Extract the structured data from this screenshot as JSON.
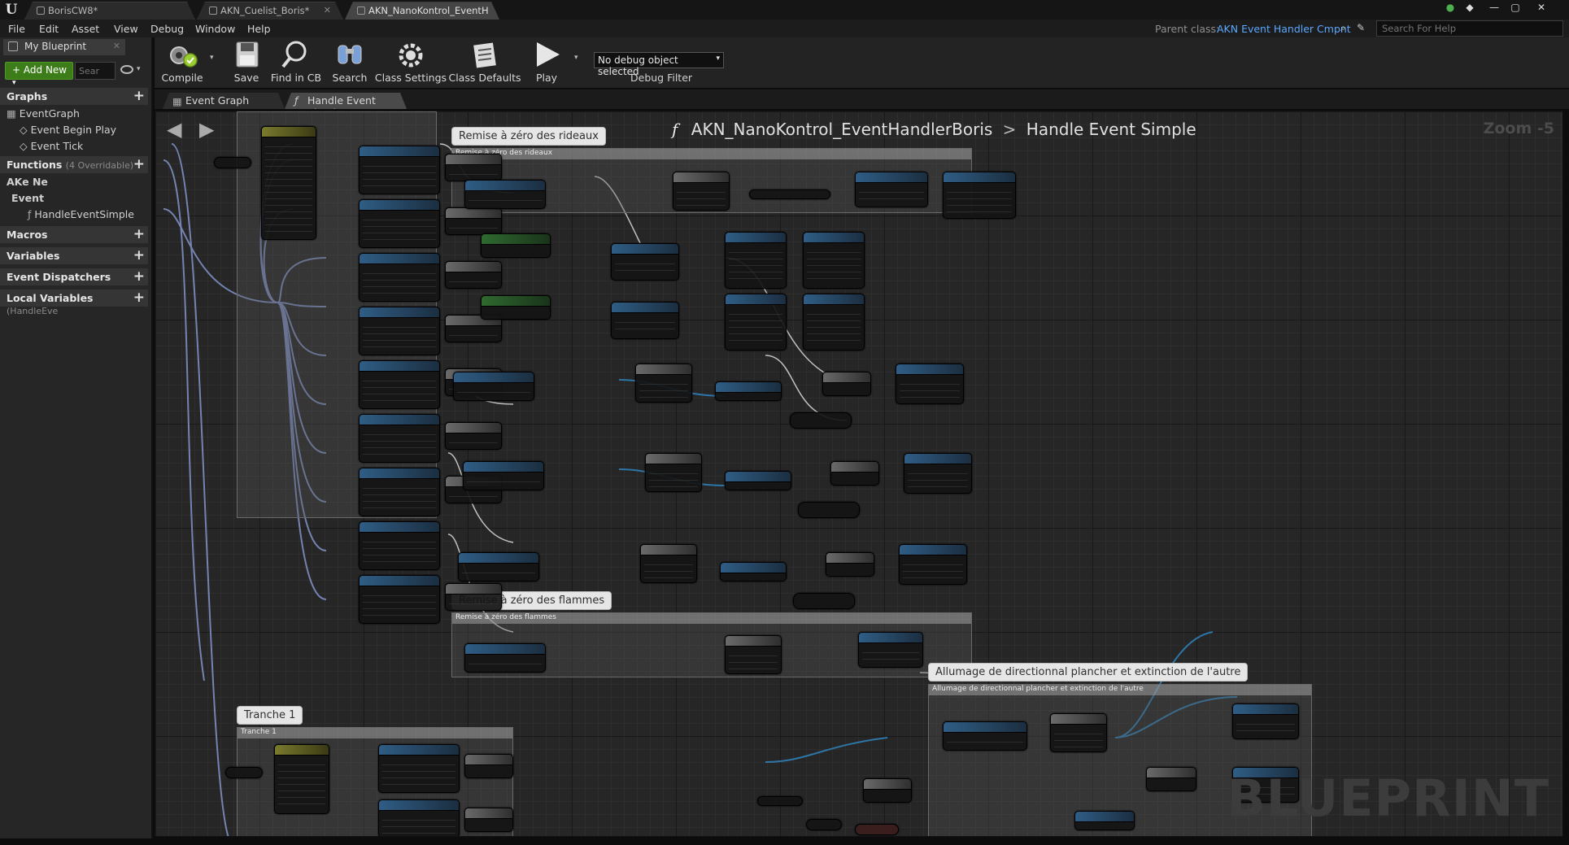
{
  "titlebar": {
    "tabs": [
      {
        "label": "BorisCW8*"
      },
      {
        "label": "AKN_Cuelist_Boris*"
      },
      {
        "label": "AKN_NanoKontrol_EventH"
      }
    ]
  },
  "menu": {
    "items": [
      "File",
      "Edit",
      "Asset",
      "View",
      "Debug",
      "Window",
      "Help"
    ],
    "parent_class_label": "Parent class:",
    "parent_class_value": "AKN Event Handler Cmpnt",
    "help_placeholder": "Search For Help"
  },
  "left_panel": {
    "tab_label": "My Blueprint",
    "add_new_label": "Add New",
    "search_placeholder": "Sear",
    "sections": {
      "graphs": "Graphs",
      "functions": "Functions",
      "functions_note": "(4 Overridable)",
      "macros": "Macros",
      "variables": "Variables",
      "dispatchers": "Event Dispatchers",
      "local_vars": "Local Variables",
      "local_vars_note": "(HandleEve"
    },
    "tree": {
      "event_graph": "EventGraph",
      "event_begin_play": "Event Begin Play",
      "event_tick": "Event Tick",
      "ake_ne": "AKe Ne",
      "event": "Event",
      "handle_event_simple": "HandleEventSimple"
    }
  },
  "toolbar": {
    "compile": "Compile",
    "save": "Save",
    "find_in_cb": "Find in CB",
    "search": "Search",
    "class_settings": "Class Settings",
    "class_defaults": "Class Defaults",
    "play": "Play",
    "debug_select": "No debug object selected",
    "debug_filter": "Debug Filter"
  },
  "graph_tabs": [
    {
      "label": "Event Graph"
    },
    {
      "label": "Handle Event Simpl"
    }
  ],
  "graph": {
    "breadcrumb_owner": "AKN_NanoKontrol_EventHandlerBoris",
    "breadcrumb_function": "Handle Event Simple",
    "zoom": "Zoom -5",
    "watermark": "BLUEPRINT",
    "comments": [
      {
        "bubble": "Remise à zéro des rideaux",
        "header": "Remise à zéro des rideaux"
      },
      {
        "bubble": "Remise à zéro des flammes",
        "header": "Remise à zéro des flammes"
      },
      {
        "bubble": "Allumage de directionnal plancher et extinction de l'autre",
        "header": "Allumage de directionnal plancher et extinction de l'autre"
      },
      {
        "bubble": "Tranche 1",
        "header": "Tranche 1"
      }
    ]
  }
}
